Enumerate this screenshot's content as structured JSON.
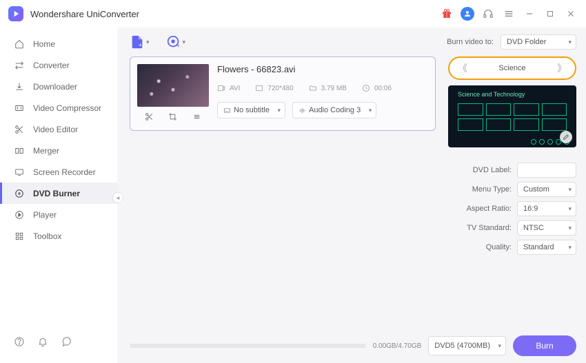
{
  "app": {
    "title": "Wondershare UniConverter"
  },
  "sidebar": {
    "items": [
      {
        "label": "Home"
      },
      {
        "label": "Converter"
      },
      {
        "label": "Downloader"
      },
      {
        "label": "Video Compressor"
      },
      {
        "label": "Video Editor"
      },
      {
        "label": "Merger"
      },
      {
        "label": "Screen Recorder"
      },
      {
        "label": "DVD Burner"
      },
      {
        "label": "Player"
      },
      {
        "label": "Toolbox"
      }
    ]
  },
  "toolbar": {
    "burn_to_label": "Burn video to:",
    "burn_to_value": "DVD Folder"
  },
  "file": {
    "name": "Flowers - 66823.avi",
    "format": "AVI",
    "resolution": "720*480",
    "size": "3.79 MB",
    "duration": "00:06",
    "subtitle": "No subtitle",
    "audio": "Audio Coding 3"
  },
  "template": {
    "name": "Science",
    "preview_title": "Science and Technology"
  },
  "settings": {
    "rows": [
      {
        "label": "DVD Label:",
        "value": "",
        "kind": "input"
      },
      {
        "label": "Menu Type:",
        "value": "Custom",
        "kind": "select"
      },
      {
        "label": "Aspect Ratio:",
        "value": "16:9",
        "kind": "select"
      },
      {
        "label": "TV Standard:",
        "value": "NTSC",
        "kind": "select"
      },
      {
        "label": "Quality:",
        "value": "Standard",
        "kind": "select"
      }
    ]
  },
  "footer": {
    "progress": "0.00GB/4.70GB",
    "disc": "DVD5 (4700MB)",
    "burn_label": "Burn"
  }
}
